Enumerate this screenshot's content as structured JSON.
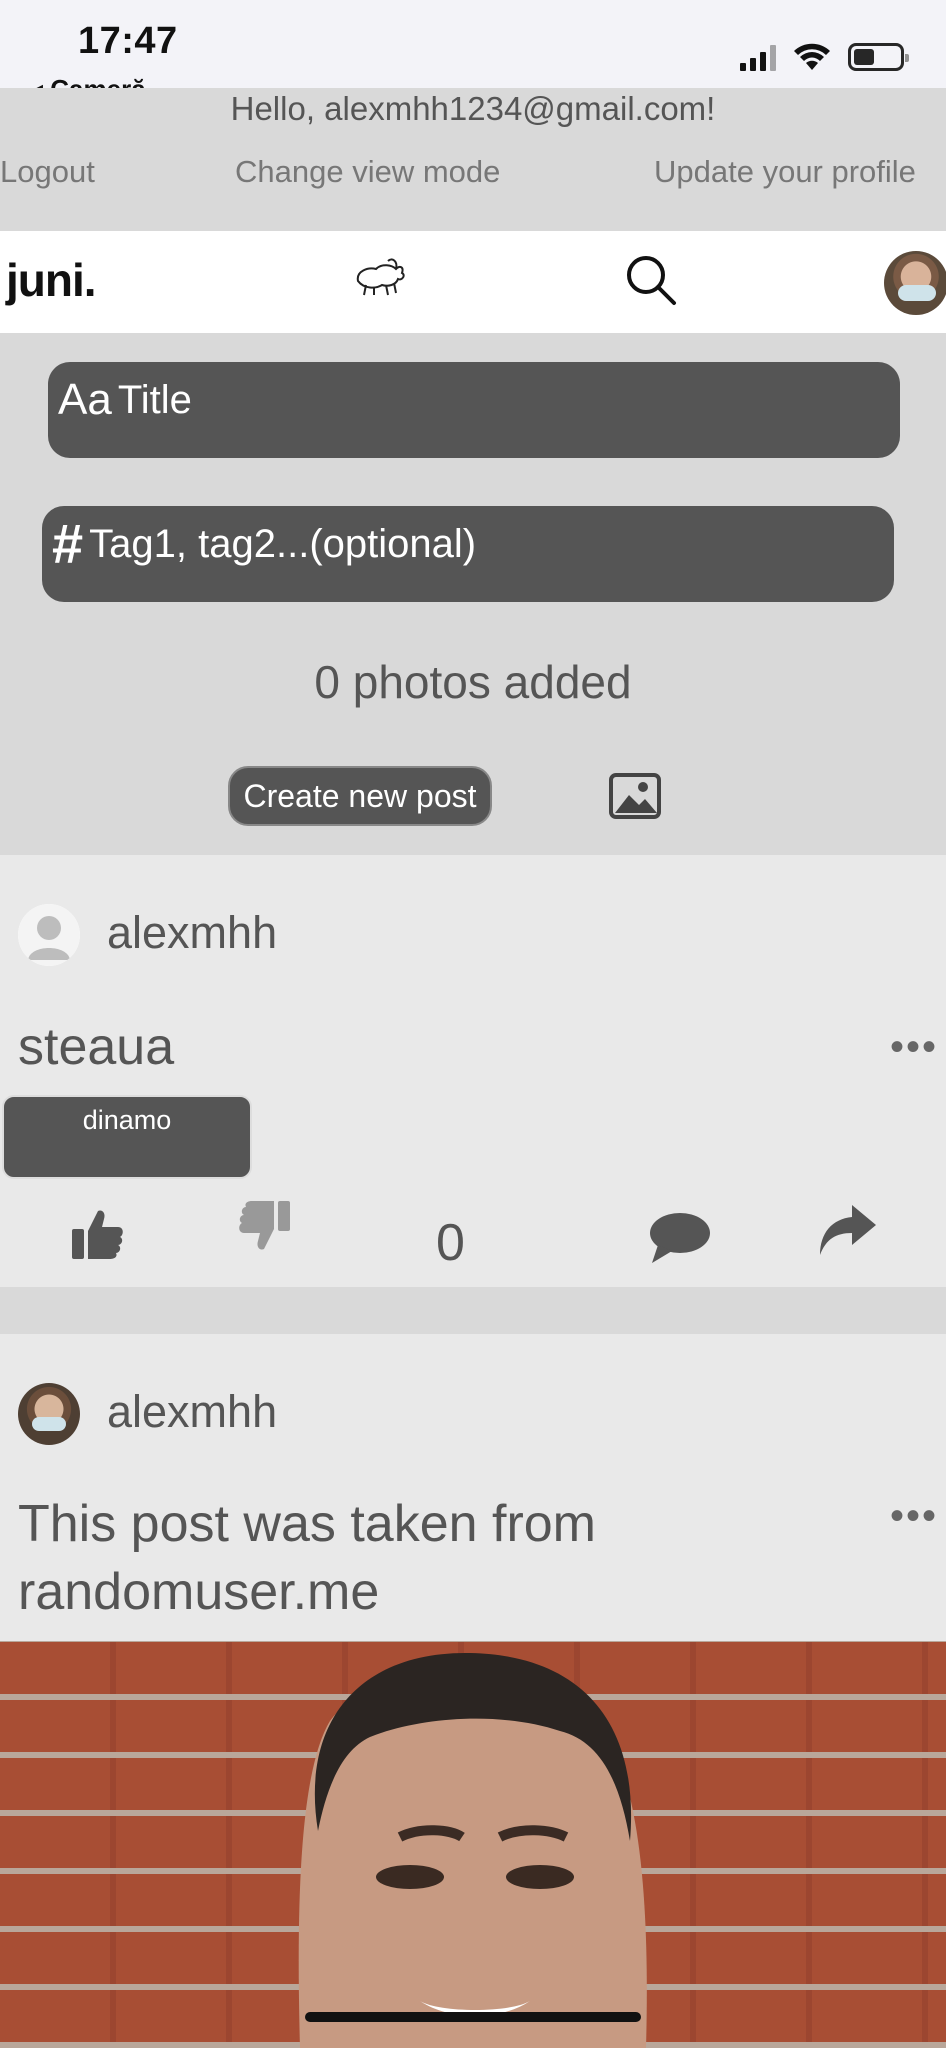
{
  "status_bar": {
    "time": "17:47",
    "back_label": "◂ Cameră",
    "icons": [
      "signal-icon",
      "wifi-icon",
      "battery-icon"
    ],
    "battery_level": 0.4
  },
  "account": {
    "greeting": "Hello, alexmhh1234@gmail.com!",
    "logout": "Logout",
    "change_view": "Change view mode",
    "update_profile": "Update your profile"
  },
  "nav": {
    "logo": "juni.",
    "icons": [
      "ram-logo-icon",
      "search-icon",
      "avatar"
    ]
  },
  "composer": {
    "title_prefix": "Aa",
    "title_placeholder": "Title",
    "tags_prefix": "#",
    "tags_placeholder": "Tag1, tag2...(optional)",
    "photos_added": "0 photos added",
    "create_button": "Create new post",
    "image_icon": "image-icon"
  },
  "posts": [
    {
      "author": "alexmhh",
      "title": "steaua",
      "more": "•••",
      "tags": [
        "dinamo"
      ],
      "score": "0",
      "actions": [
        "thumbs-up-icon",
        "thumbs-down-icon",
        "comment-icon",
        "share-icon"
      ]
    },
    {
      "author": "alexmhh",
      "title": "This post was taken from randomuser.me",
      "more": "•••"
    }
  ],
  "colors": {
    "background": "#d9d9d9",
    "post_background": "#e9e9e9",
    "dark_gray": "#555555",
    "nav_background": "#ffffff"
  }
}
